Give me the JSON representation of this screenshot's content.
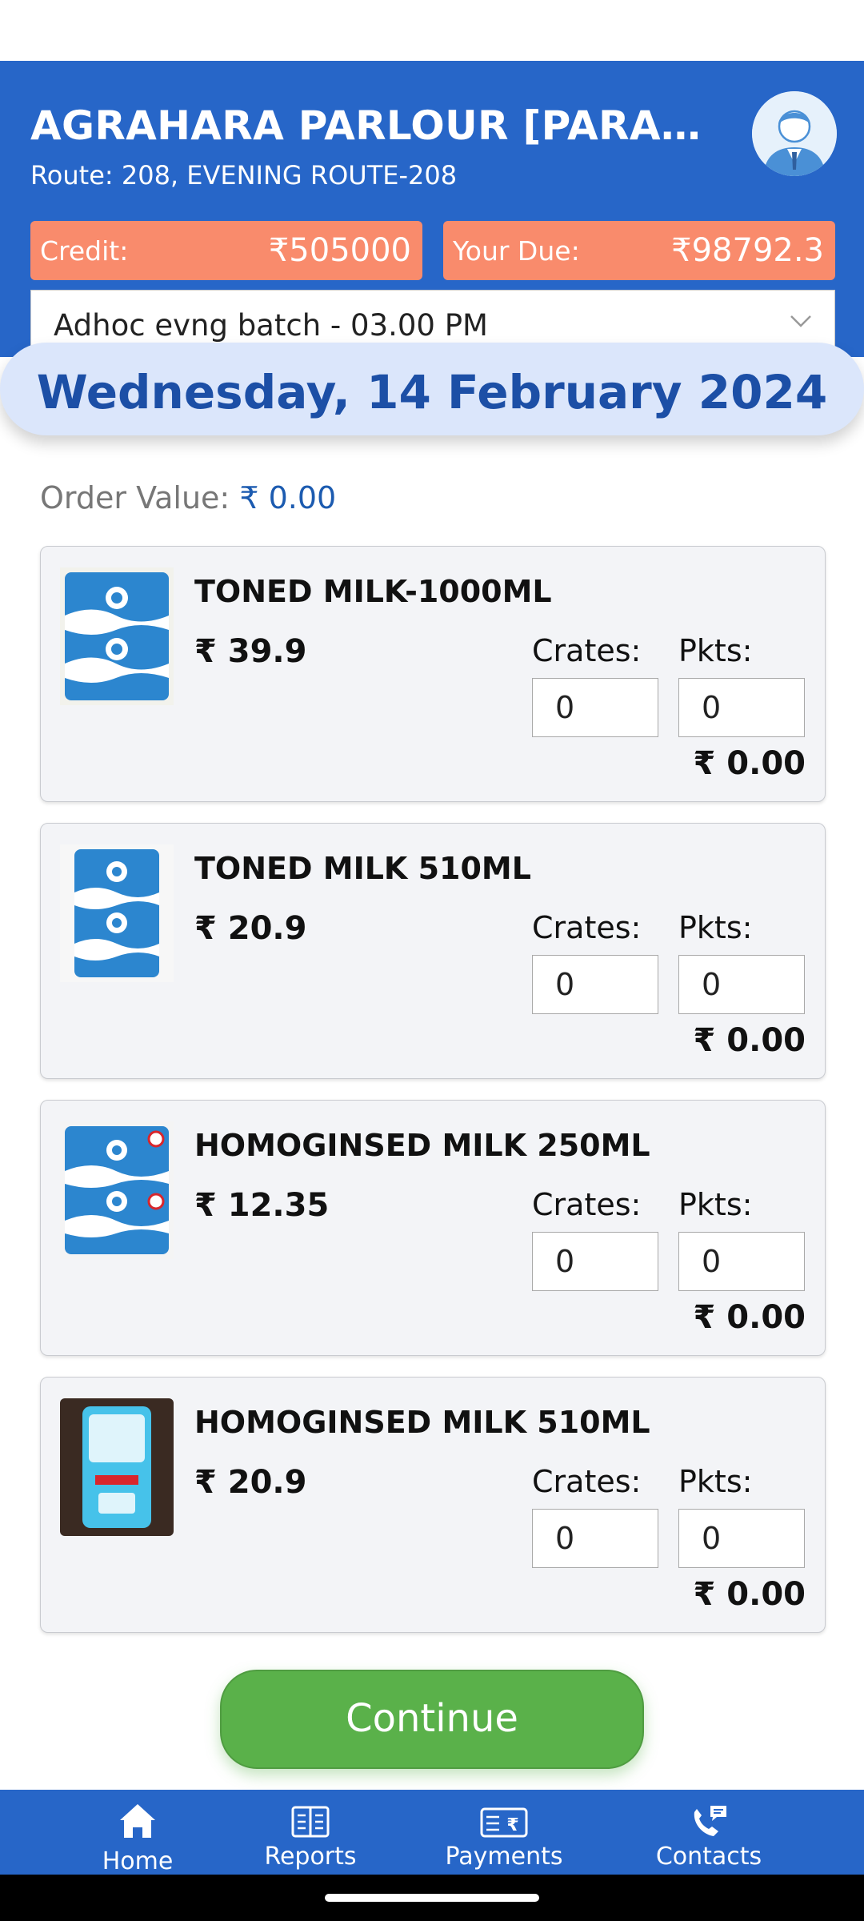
{
  "header": {
    "title": "AGRAHARA PARLOUR [PARAMESHWARA]",
    "route": "Route: 208, EVENING ROUTE-208",
    "credit_label": "Credit:",
    "credit_value": "₹505000",
    "due_label": "Your Due:",
    "due_value": "₹98792.3",
    "batch_value": "Adhoc evng batch - 03.00 PM"
  },
  "date_banner": "Wednesday, 14 February 2024",
  "order_value": {
    "label": "Order Value:",
    "amount": "₹ 0.00"
  },
  "products": [
    {
      "name": "TONED MILK-1000ML",
      "price": "₹ 39.9",
      "crates_label": "Crates:",
      "pkts_label": "Pkts:",
      "crates": "0",
      "pkts": "0",
      "total": "₹ 0.00"
    },
    {
      "name": "TONED MILK 510ML",
      "price": "₹ 20.9",
      "crates_label": "Crates:",
      "pkts_label": "Pkts:",
      "crates": "0",
      "pkts": "0",
      "total": "₹ 0.00"
    },
    {
      "name": "HOMOGINSED MILK 250ML",
      "price": "₹ 12.35",
      "crates_label": "Crates:",
      "pkts_label": "Pkts:",
      "crates": "0",
      "pkts": "0",
      "total": "₹ 0.00"
    },
    {
      "name": "HOMOGINSED MILK 510ML",
      "price": "₹ 20.9",
      "crates_label": "Crates:",
      "pkts_label": "Pkts:",
      "crates": "0",
      "pkts": "0",
      "total": "₹ 0.00"
    }
  ],
  "continue_label": "Continue",
  "nav": [
    {
      "label": "Home",
      "icon": "home-icon"
    },
    {
      "label": "Reports",
      "icon": "book-icon"
    },
    {
      "label": "Payments",
      "icon": "rupee-bill-icon"
    },
    {
      "label": "Contacts",
      "icon": "phone-chat-icon"
    }
  ],
  "colors": {
    "primary": "#2766c8",
    "chip": "#f98b6c",
    "date_pill": "#dbe6fb",
    "date_text": "#1c4fa6",
    "continue": "#5ab14a"
  }
}
